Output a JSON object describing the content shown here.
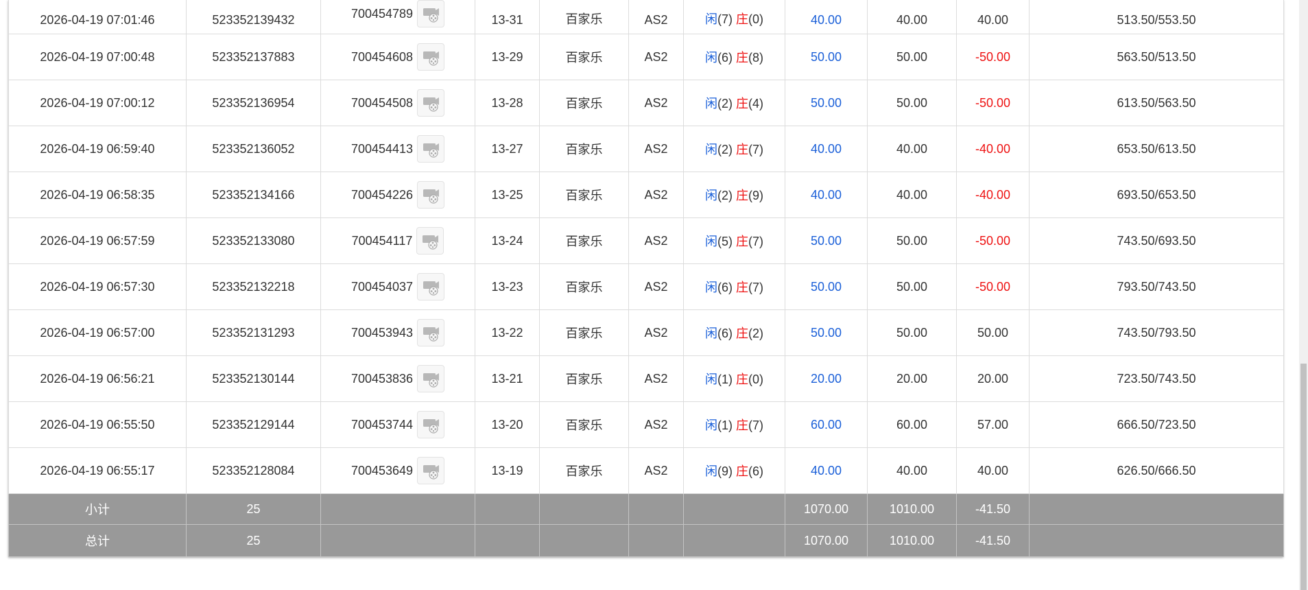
{
  "rows": [
    {
      "time": "2026-04-19 07:01:46",
      "bet_id": "523352139432",
      "round_id": "700454789",
      "shoe": "13-31",
      "game": "百家乐",
      "table": "AS2",
      "player_label": "闲",
      "player_score": "(7)",
      "banker_label": "庄",
      "banker_score": "(0)",
      "bet": "40.00",
      "valid_bet": "40.00",
      "win_loss": "40.00",
      "win_loss_negative": false,
      "balance": "513.50/553.50"
    },
    {
      "time": "2026-04-19 07:00:48",
      "bet_id": "523352137883",
      "round_id": "700454608",
      "shoe": "13-29",
      "game": "百家乐",
      "table": "AS2",
      "player_label": "闲",
      "player_score": "(6)",
      "banker_label": "庄",
      "banker_score": "(8)",
      "bet": "50.00",
      "valid_bet": "50.00",
      "win_loss": "-50.00",
      "win_loss_negative": true,
      "balance": "563.50/513.50"
    },
    {
      "time": "2026-04-19 07:00:12",
      "bet_id": "523352136954",
      "round_id": "700454508",
      "shoe": "13-28",
      "game": "百家乐",
      "table": "AS2",
      "player_label": "闲",
      "player_score": "(2)",
      "banker_label": "庄",
      "banker_score": "(4)",
      "bet": "50.00",
      "valid_bet": "50.00",
      "win_loss": "-50.00",
      "win_loss_negative": true,
      "balance": "613.50/563.50"
    },
    {
      "time": "2026-04-19 06:59:40",
      "bet_id": "523352136052",
      "round_id": "700454413",
      "shoe": "13-27",
      "game": "百家乐",
      "table": "AS2",
      "player_label": "闲",
      "player_score": "(2)",
      "banker_label": "庄",
      "banker_score": "(7)",
      "bet": "40.00",
      "valid_bet": "40.00",
      "win_loss": "-40.00",
      "win_loss_negative": true,
      "balance": "653.50/613.50"
    },
    {
      "time": "2026-04-19 06:58:35",
      "bet_id": "523352134166",
      "round_id": "700454226",
      "shoe": "13-25",
      "game": "百家乐",
      "table": "AS2",
      "player_label": "闲",
      "player_score": "(2)",
      "banker_label": "庄",
      "banker_score": "(9)",
      "bet": "40.00",
      "valid_bet": "40.00",
      "win_loss": "-40.00",
      "win_loss_negative": true,
      "balance": "693.50/653.50"
    },
    {
      "time": "2026-04-19 06:57:59",
      "bet_id": "523352133080",
      "round_id": "700454117",
      "shoe": "13-24",
      "game": "百家乐",
      "table": "AS2",
      "player_label": "闲",
      "player_score": "(5)",
      "banker_label": "庄",
      "banker_score": "(7)",
      "bet": "50.00",
      "valid_bet": "50.00",
      "win_loss": "-50.00",
      "win_loss_negative": true,
      "balance": "743.50/693.50"
    },
    {
      "time": "2026-04-19 06:57:30",
      "bet_id": "523352132218",
      "round_id": "700454037",
      "shoe": "13-23",
      "game": "百家乐",
      "table": "AS2",
      "player_label": "闲",
      "player_score": "(6)",
      "banker_label": "庄",
      "banker_score": "(7)",
      "bet": "50.00",
      "valid_bet": "50.00",
      "win_loss": "-50.00",
      "win_loss_negative": true,
      "balance": "793.50/743.50"
    },
    {
      "time": "2026-04-19 06:57:00",
      "bet_id": "523352131293",
      "round_id": "700453943",
      "shoe": "13-22",
      "game": "百家乐",
      "table": "AS2",
      "player_label": "闲",
      "player_score": "(6)",
      "banker_label": "庄",
      "banker_score": "(2)",
      "bet": "50.00",
      "valid_bet": "50.00",
      "win_loss": "50.00",
      "win_loss_negative": false,
      "balance": "743.50/793.50"
    },
    {
      "time": "2026-04-19 06:56:21",
      "bet_id": "523352130144",
      "round_id": "700453836",
      "shoe": "13-21",
      "game": "百家乐",
      "table": "AS2",
      "player_label": "闲",
      "player_score": "(1)",
      "banker_label": "庄",
      "banker_score": "(0)",
      "bet": "20.00",
      "valid_bet": "20.00",
      "win_loss": "20.00",
      "win_loss_negative": false,
      "balance": "723.50/743.50"
    },
    {
      "time": "2026-04-19 06:55:50",
      "bet_id": "523352129144",
      "round_id": "700453744",
      "shoe": "13-20",
      "game": "百家乐",
      "table": "AS2",
      "player_label": "闲",
      "player_score": "(1)",
      "banker_label": "庄",
      "banker_score": "(7)",
      "bet": "60.00",
      "valid_bet": "60.00",
      "win_loss": "57.00",
      "win_loss_negative": false,
      "balance": "666.50/723.50"
    },
    {
      "time": "2026-04-19 06:55:17",
      "bet_id": "523352128084",
      "round_id": "700453649",
      "shoe": "13-19",
      "game": "百家乐",
      "table": "AS2",
      "player_label": "闲",
      "player_score": "(9)",
      "banker_label": "庄",
      "banker_score": "(6)",
      "bet": "40.00",
      "valid_bet": "40.00",
      "win_loss": "40.00",
      "win_loss_negative": false,
      "balance": "626.50/666.50"
    }
  ],
  "subtotal": {
    "label": "小计",
    "count": "25",
    "bet": "1070.00",
    "valid_bet": "1010.00",
    "win_loss": "-41.50"
  },
  "total": {
    "label": "总计",
    "count": "25",
    "bet": "1070.00",
    "valid_bet": "1010.00",
    "win_loss": "-41.50"
  },
  "colors": {
    "player": "#1a5fd8",
    "banker": "#ee1111",
    "summary_bg": "#999999"
  },
  "icons": {
    "replay": "video-replay-icon"
  }
}
